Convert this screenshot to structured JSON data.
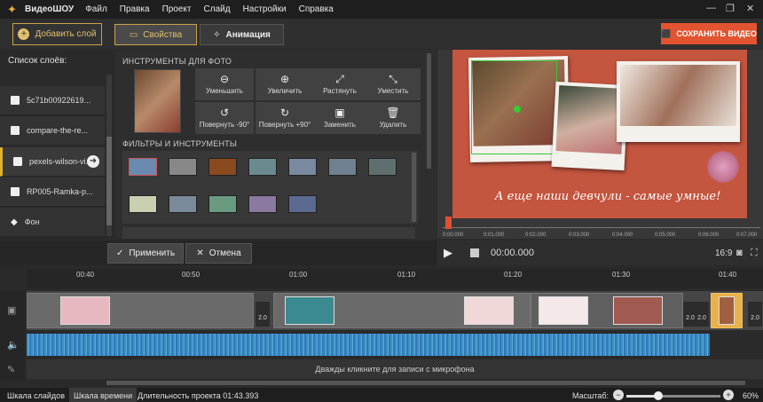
{
  "menu": {
    "app": "ВидеоШОУ",
    "items": [
      "Файл",
      "Правка",
      "Проект",
      "Слайд",
      "Настройки",
      "Справка"
    ]
  },
  "toolbar": {
    "add_layer": "Добавить слой",
    "tab_properties": "Свойства",
    "tab_animation": "Анимация",
    "save_video": "СОХРАНИТЬ ВИДЕО"
  },
  "layers": {
    "title": "Список слоёв:",
    "items": [
      "5c71b00922619...",
      "compare-the-re...",
      "pexels-wilson-vi...",
      "RP005-Ramka-p...",
      "Фон"
    ]
  },
  "photo_tools": {
    "title": "ИНСТРУМЕНТЫ ДЛЯ ФОТО",
    "buttons": [
      "Уменьшить",
      "Увеличить",
      "Растянуть",
      "Уместить",
      "Повернуть -90°",
      "Повернуть +90°",
      "Заменить",
      "Удалить"
    ]
  },
  "filters": {
    "title": "ФИЛЬТРЫ И ИНСТРУМЕНТЫ"
  },
  "actions": {
    "apply": "Применить",
    "cancel": "Отмена"
  },
  "preview": {
    "caption": "А еще наши девчули - самые умные!",
    "ruler": [
      "0:00.000",
      "0:01.000",
      "0:02.000",
      "0:03.000",
      "0:04.000",
      "0:05.000",
      "0:06.000",
      "0:07.000"
    ],
    "timecode": "00:00.000",
    "aspect": "16:9"
  },
  "timeline": {
    "marks": [
      "00:40",
      "00:50",
      "01:00",
      "01:10",
      "01:20",
      "01:30",
      "01:40"
    ],
    "transitions": [
      "2.0",
      "2.0",
      "2.0",
      "2.0"
    ],
    "mic_hint": "Дважды кликните для записи с микрофона"
  },
  "status": {
    "tab_slides": "Шкала слайдов",
    "tab_timeline": "Шкала времени",
    "duration": "Длительность проекта 01:43.393",
    "scale_label": "Масштаб:",
    "zoom": "60%"
  },
  "colors": {
    "accent": "#e2542f",
    "highlight": "#c9a24a",
    "canvas_bg": "#c4553f",
    "audio": "#3e8ec8"
  }
}
